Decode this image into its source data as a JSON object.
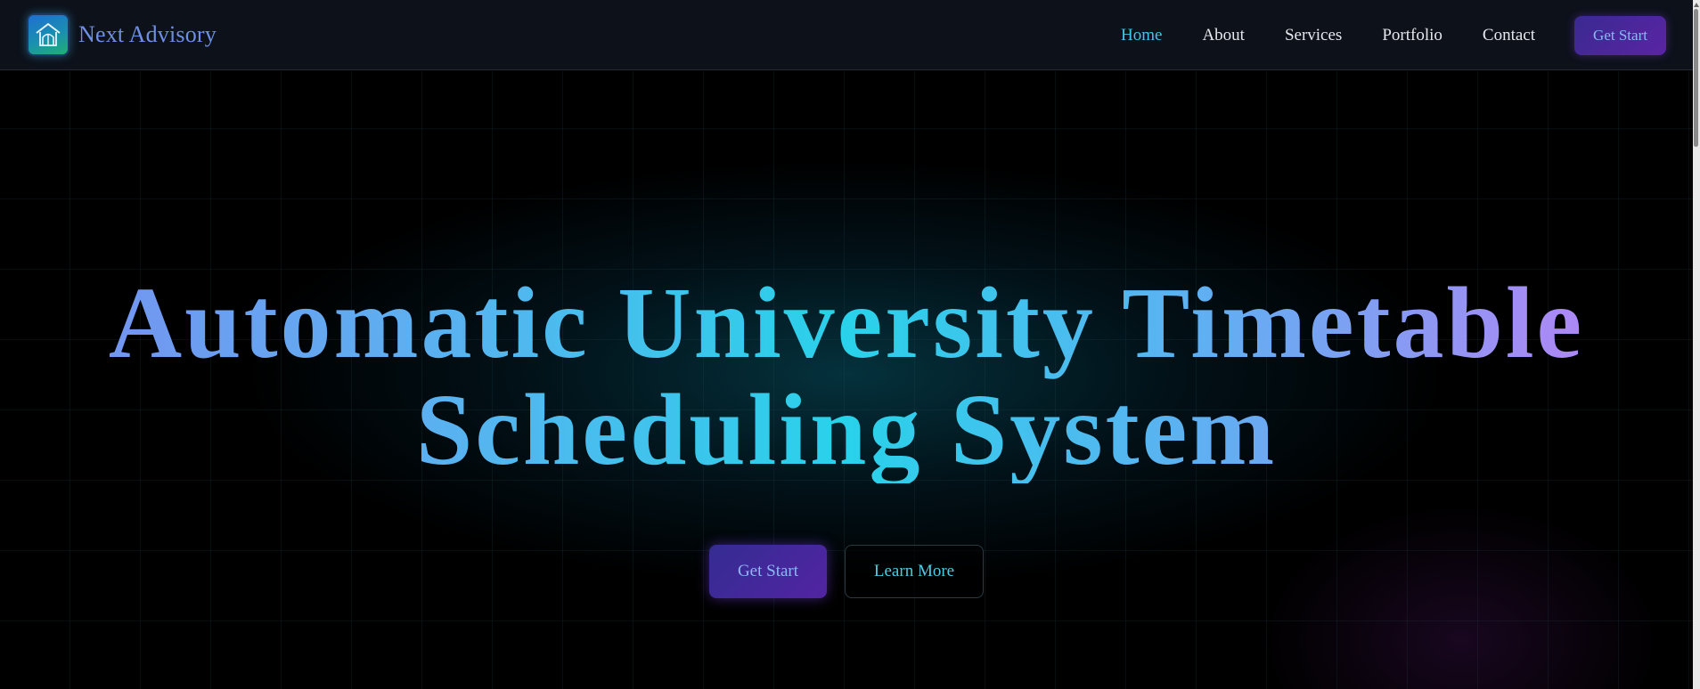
{
  "header": {
    "brand_name": "Next Advisory",
    "logo_icon": "house-logo-icon",
    "nav": [
      {
        "label": "Home",
        "active": true
      },
      {
        "label": "About",
        "active": false
      },
      {
        "label": "Services",
        "active": false
      },
      {
        "label": "Portfolio",
        "active": false
      },
      {
        "label": "Contact",
        "active": false
      }
    ],
    "cta_label": "Get Start"
  },
  "hero": {
    "title_line1": "Automatic University Timetable",
    "title_line2": "Scheduling System",
    "primary_button": "Get Start",
    "secondary_button": "Learn More"
  },
  "colors": {
    "background": "#000000",
    "navbar_bg": "#0d111a",
    "active_link": "#41c6e8",
    "accent_cyan": "#29d2ea",
    "accent_purple": "#5224a2",
    "brand_text": "#6d8fe6"
  }
}
